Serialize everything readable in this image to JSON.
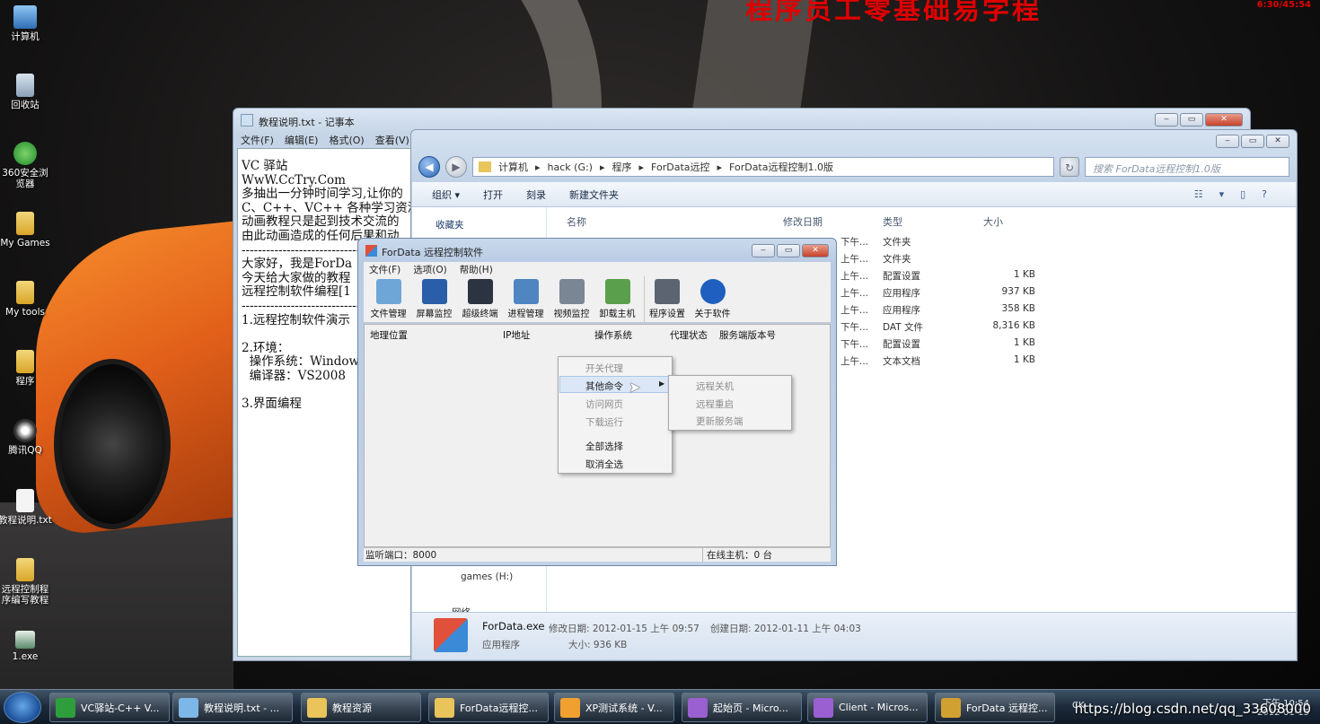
{
  "overlay": {
    "banner": "程序员工零基础易学程",
    "timer": "6:30/45:54"
  },
  "desktop": {
    "icons": [
      "计算机",
      "回收站",
      "360安全浏览器",
      "My Games",
      "My tools",
      "程序",
      "腾讯QQ",
      "教程说明.txt",
      "远程控制程序编写教程",
      "1.exe"
    ]
  },
  "notepad": {
    "title": "教程说明.txt - 记事本",
    "menu": [
      "文件(F)",
      "编辑(E)",
      "格式(O)",
      "查看(V)"
    ],
    "body": "VC 驿站\nWwW.CcTry.Com\n多抽出一分钟时间学习,让你的\nC、C++、VC++ 各种学习资源,\n动画教程只是起到技术交流的\n由此动画造成的任何后果和动\n------------------------------------\n大家好，我是ForDa\n今天给大家做的教程\n远程控制软件编程[1\n------------------------------------\n1.远程控制软件演示\n\n2.环境：\n  操作系统：Window\n  编译器：VS2008\n\n3.界面编程"
  },
  "explorer": {
    "address": [
      "计算机",
      "hack (G:)",
      "程序",
      "ForData远控",
      "ForData远程控制1.0版"
    ],
    "search_placeholder": "搜索 ForData远程控制1.0版",
    "commands": [
      "组织 ▾",
      "打开",
      "刻录",
      "新建文件夹"
    ],
    "nav": {
      "favorites": "收藏夹",
      "drive": "games (H:)",
      "network": "网络"
    },
    "columns": [
      "名称",
      "修改日期",
      "类型",
      "大小"
    ],
    "rows": [
      {
        "date": "下午...",
        "type": "文件夹",
        "size": ""
      },
      {
        "date": "上午...",
        "type": "文件夹",
        "size": ""
      },
      {
        "date": "上午...",
        "type": "配置设置",
        "size": "1 KB"
      },
      {
        "date": "上午...",
        "type": "应用程序",
        "size": "937 KB"
      },
      {
        "date": "上午...",
        "type": "应用程序",
        "size": "358 KB"
      },
      {
        "date": "下午...",
        "type": "DAT 文件",
        "size": "8,316 KB"
      },
      {
        "date": "下午...",
        "type": "配置设置",
        "size": "1 KB"
      },
      {
        "date": "上午...",
        "type": "文本文档",
        "size": "1 KB"
      }
    ],
    "details": {
      "name": "ForData.exe",
      "modified": "修改日期: 2012-01-15 上午 09:57",
      "created": "创建日期: 2012-01-11 上午 04:03",
      "type": "应用程序",
      "size": "大小: 936 KB"
    }
  },
  "fordata": {
    "title": "ForData 远程控制软件",
    "menu": [
      "文件(F)",
      "选项(O)",
      "帮助(H)"
    ],
    "tools": [
      {
        "label": "文件管理",
        "icon": "file-manager-icon",
        "color": "#6fa6d8"
      },
      {
        "label": "屏幕监控",
        "icon": "monitor-icon",
        "color": "#2a5ea8"
      },
      {
        "label": "超级终端",
        "icon": "terminal-icon",
        "color": "#2b3440"
      },
      {
        "label": "进程管理",
        "icon": "process-icon",
        "color": "#4f86c2"
      },
      {
        "label": "视频监控",
        "icon": "webcam-icon",
        "color": "#7a8694"
      },
      {
        "label": "卸载主机",
        "icon": "recycle-icon",
        "color": "#5aa04c"
      },
      {
        "label": "程序设置",
        "icon": "tools-icon",
        "color": "#5b6470"
      },
      {
        "label": "关于软件",
        "icon": "info-icon",
        "color": "#1f5fbf"
      }
    ],
    "columns": [
      "地理位置",
      "IP地址",
      "操作系统",
      "代理状态",
      "服务端版本号"
    ],
    "status_port": "监听端口：8000",
    "status_online": "在线主机：0 台",
    "context_menu": {
      "items": [
        "开关代理",
        "其他命令",
        "访问网页",
        "下载运行",
        "全部选择",
        "取消全选"
      ]
    },
    "submenu": {
      "items": [
        "远程关机",
        "远程重启",
        "更新服务端"
      ]
    }
  },
  "taskbar": {
    "buttons": [
      {
        "label": "VC驿站-C++ V...",
        "color": "#2e9e3c"
      },
      {
        "label": "教程说明.txt - ...",
        "color": "#7db7e8"
      },
      {
        "label": "教程资源",
        "color": "#e8c45a"
      },
      {
        "label": "ForData远程控...",
        "color": "#e8c45a"
      },
      {
        "label": "XP测试系统 - V...",
        "color": "#f0a030"
      },
      {
        "label": "起始页 - Micro...",
        "color": "#9a5fd0"
      },
      {
        "label": "Client - Micros...",
        "color": "#9a5fd0"
      },
      {
        "label": "ForData 远程控...",
        "color": "#d0a030"
      }
    ],
    "tray": {
      "lang": "CK",
      "time": "下午 10:54",
      "date": "2012-01-15"
    },
    "watermark": "https://blog.csdn.net/qq_33608000"
  }
}
